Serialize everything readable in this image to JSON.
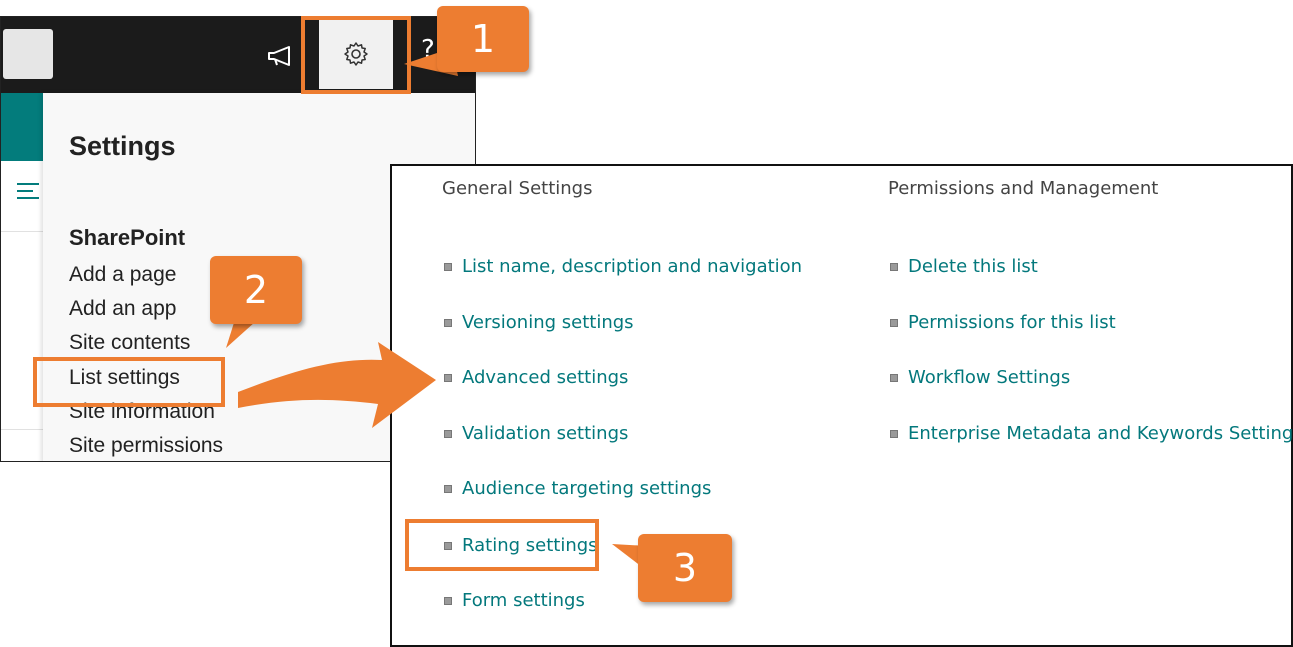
{
  "settings_panel": {
    "title": "Settings",
    "section": "SharePoint",
    "items": [
      {
        "label": "Add a page"
      },
      {
        "label": "Add an app"
      },
      {
        "label": "Site contents"
      },
      {
        "label": "List settings"
      },
      {
        "label": "Site information"
      },
      {
        "label": "Site permissions"
      }
    ]
  },
  "list_settings": {
    "general": {
      "heading": "General Settings",
      "links": [
        "List name, description and navigation",
        "Versioning settings",
        "Advanced settings",
        "Validation settings",
        "Audience targeting settings",
        "Rating settings",
        "Form settings"
      ]
    },
    "permissions": {
      "heading": "Permissions and Management",
      "links": [
        "Delete this list",
        "Permissions for this list",
        "Workflow Settings",
        "Enterprise Metadata and Keywords Settings"
      ]
    }
  },
  "topbar": {
    "icons": [
      "megaphone-icon",
      "gear-icon",
      "help-icon"
    ],
    "help_glyph": "?"
  },
  "annotations": {
    "step1": "1",
    "step2": "2",
    "step3": "3",
    "accent": "#ed7d31"
  },
  "colors": {
    "link": "#03787c",
    "teal": "#037c7c",
    "topbar": "#1b1b1b"
  }
}
